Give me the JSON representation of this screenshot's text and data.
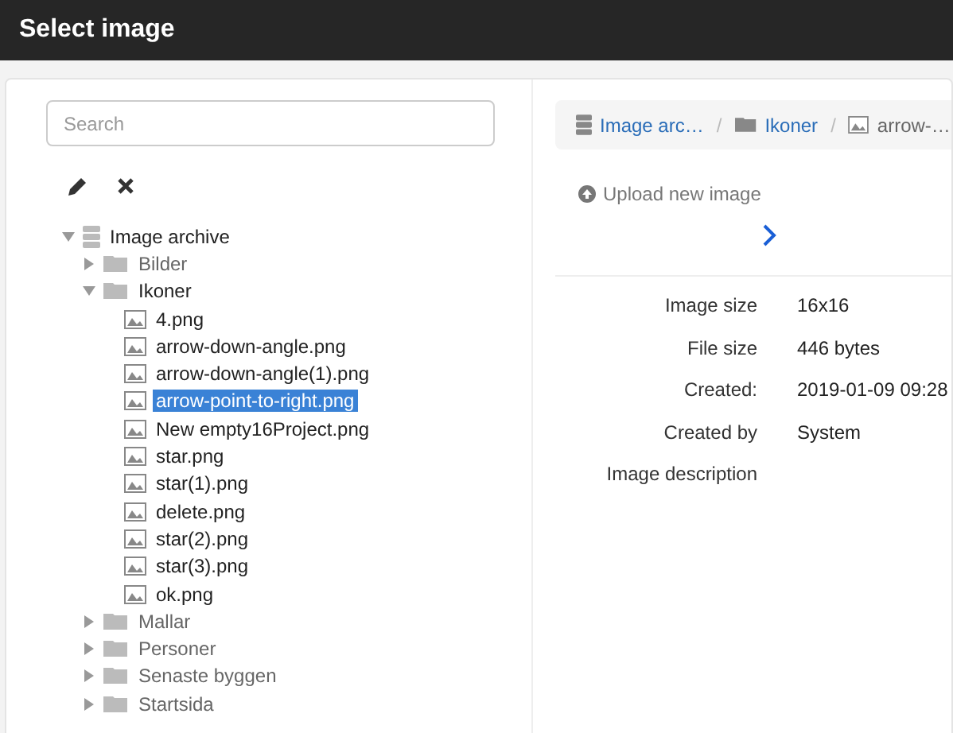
{
  "window": {
    "title": "Select image"
  },
  "search": {
    "placeholder": "Search"
  },
  "tree": [
    {
      "kind": "archive",
      "label": "Image archive",
      "expanded": true,
      "children": [
        {
          "kind": "folder",
          "label": "Bilder",
          "expanded": false
        },
        {
          "kind": "folder",
          "label": "Ikoner",
          "expanded": true,
          "children": [
            {
              "kind": "file",
              "label": "4.png",
              "selected": false
            },
            {
              "kind": "file",
              "label": "arrow-down-angle.png",
              "selected": false
            },
            {
              "kind": "file",
              "label": "arrow-down-angle(1).png",
              "selected": false
            },
            {
              "kind": "file",
              "label": "arrow-point-to-right.png",
              "selected": true
            },
            {
              "kind": "file",
              "label": "New empty16Project.png",
              "selected": false
            },
            {
              "kind": "file",
              "label": "star.png",
              "selected": false
            },
            {
              "kind": "file",
              "label": "star(1).png",
              "selected": false
            },
            {
              "kind": "file",
              "label": "delete.png",
              "selected": false
            },
            {
              "kind": "file",
              "label": "star(2).png",
              "selected": false
            },
            {
              "kind": "file",
              "label": "star(3).png",
              "selected": false
            },
            {
              "kind": "file",
              "label": "ok.png",
              "selected": false
            }
          ]
        },
        {
          "kind": "folder",
          "label": "Mallar",
          "expanded": false
        },
        {
          "kind": "folder",
          "label": "Personer",
          "expanded": false
        },
        {
          "kind": "folder",
          "label": "Senaste byggen",
          "expanded": false
        },
        {
          "kind": "folder",
          "label": "Startsida",
          "expanded": false
        }
      ]
    }
  ],
  "breadcrumb": [
    {
      "kind": "archive",
      "label": "Image arc…"
    },
    {
      "kind": "folder",
      "label": "Ikoner",
      "separator": "/"
    },
    {
      "kind": "file",
      "label": "arrow-…",
      "separator": "/"
    }
  ],
  "upload": {
    "label": "Upload new image"
  },
  "details": [
    {
      "label": "Image size",
      "value": "16x16"
    },
    {
      "label": "File size",
      "value": "446 bytes"
    },
    {
      "label": "Created:",
      "value": "2019-01-09 09:28"
    },
    {
      "label": "Created by",
      "value": "System"
    },
    {
      "label": "Image description"
    }
  ]
}
